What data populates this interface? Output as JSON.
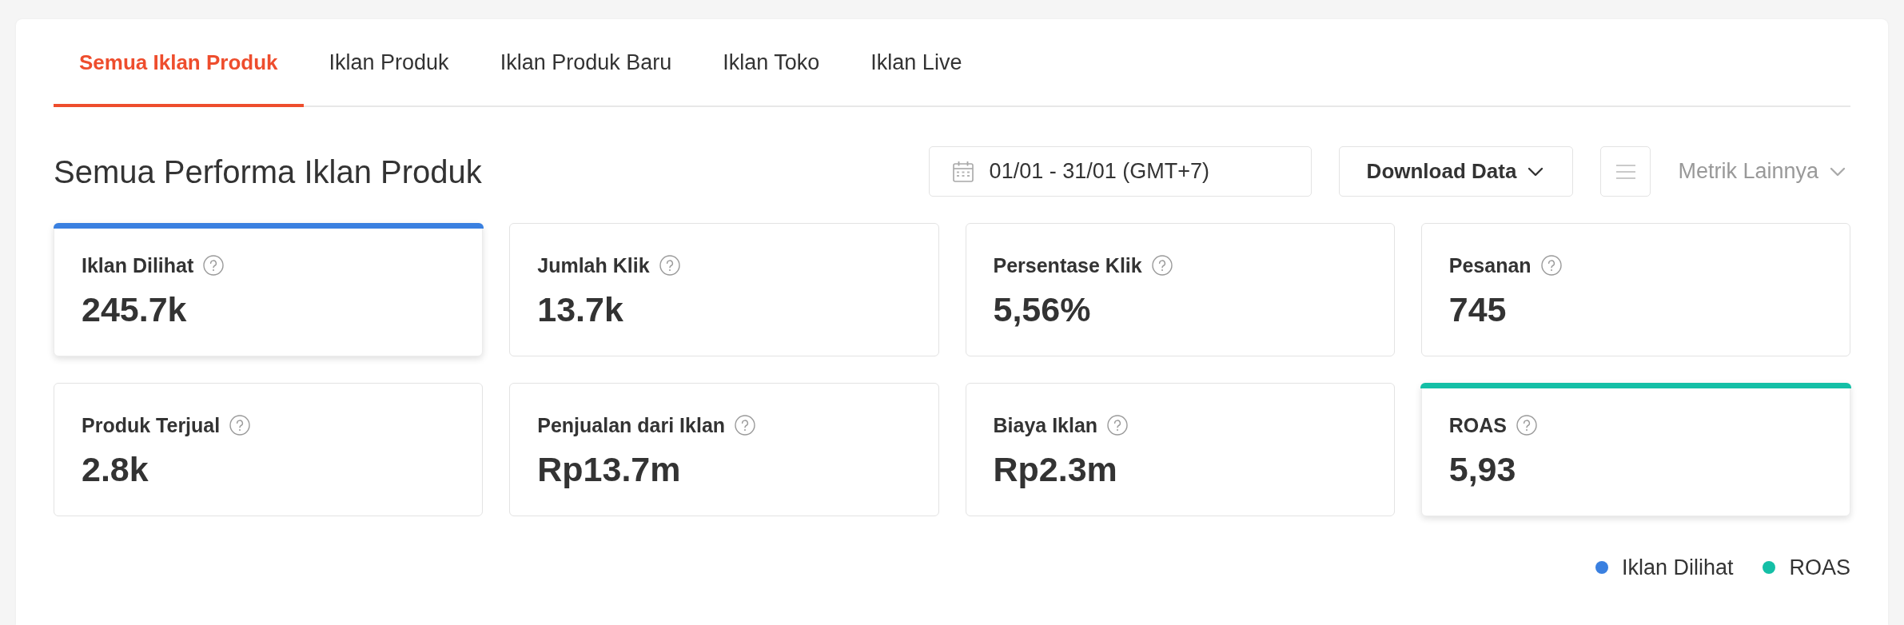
{
  "tabs": [
    {
      "label": "Semua Iklan Produk",
      "selected": true
    },
    {
      "label": "Iklan Produk",
      "selected": false
    },
    {
      "label": "Iklan Produk Baru",
      "selected": false
    },
    {
      "label": "Iklan Toko",
      "selected": false
    },
    {
      "label": "Iklan Live",
      "selected": false
    }
  ],
  "header": {
    "title": "Semua Performa Iklan Produk",
    "date_range": "01/01 - 31/01 (GMT+7)",
    "download_button": "Download Data",
    "more_metrics": "Metrik Lainnya"
  },
  "metrics": [
    {
      "label": "Iklan Dilihat",
      "value": "245.7k",
      "selected": true,
      "color": "#3a80e0"
    },
    {
      "label": "Jumlah Klik",
      "value": "13.7k",
      "selected": false
    },
    {
      "label": "Persentase Klik",
      "value": "5,56%",
      "selected": false
    },
    {
      "label": "Pesanan",
      "value": "745",
      "selected": false
    },
    {
      "label": "Produk Terjual",
      "value": "2.8k",
      "selected": false
    },
    {
      "label": "Penjualan dari Iklan",
      "value": "Rp13.7m",
      "selected": false
    },
    {
      "label": "Biaya Iklan",
      "value": "Rp2.3m",
      "selected": false
    },
    {
      "label": "ROAS",
      "value": "5,93",
      "selected": true,
      "color": "#14bfa6"
    }
  ],
  "legend": [
    {
      "label": "Iklan Dilihat",
      "color": "#3a80e0"
    },
    {
      "label": "ROAS",
      "color": "#14bfa6"
    }
  ]
}
